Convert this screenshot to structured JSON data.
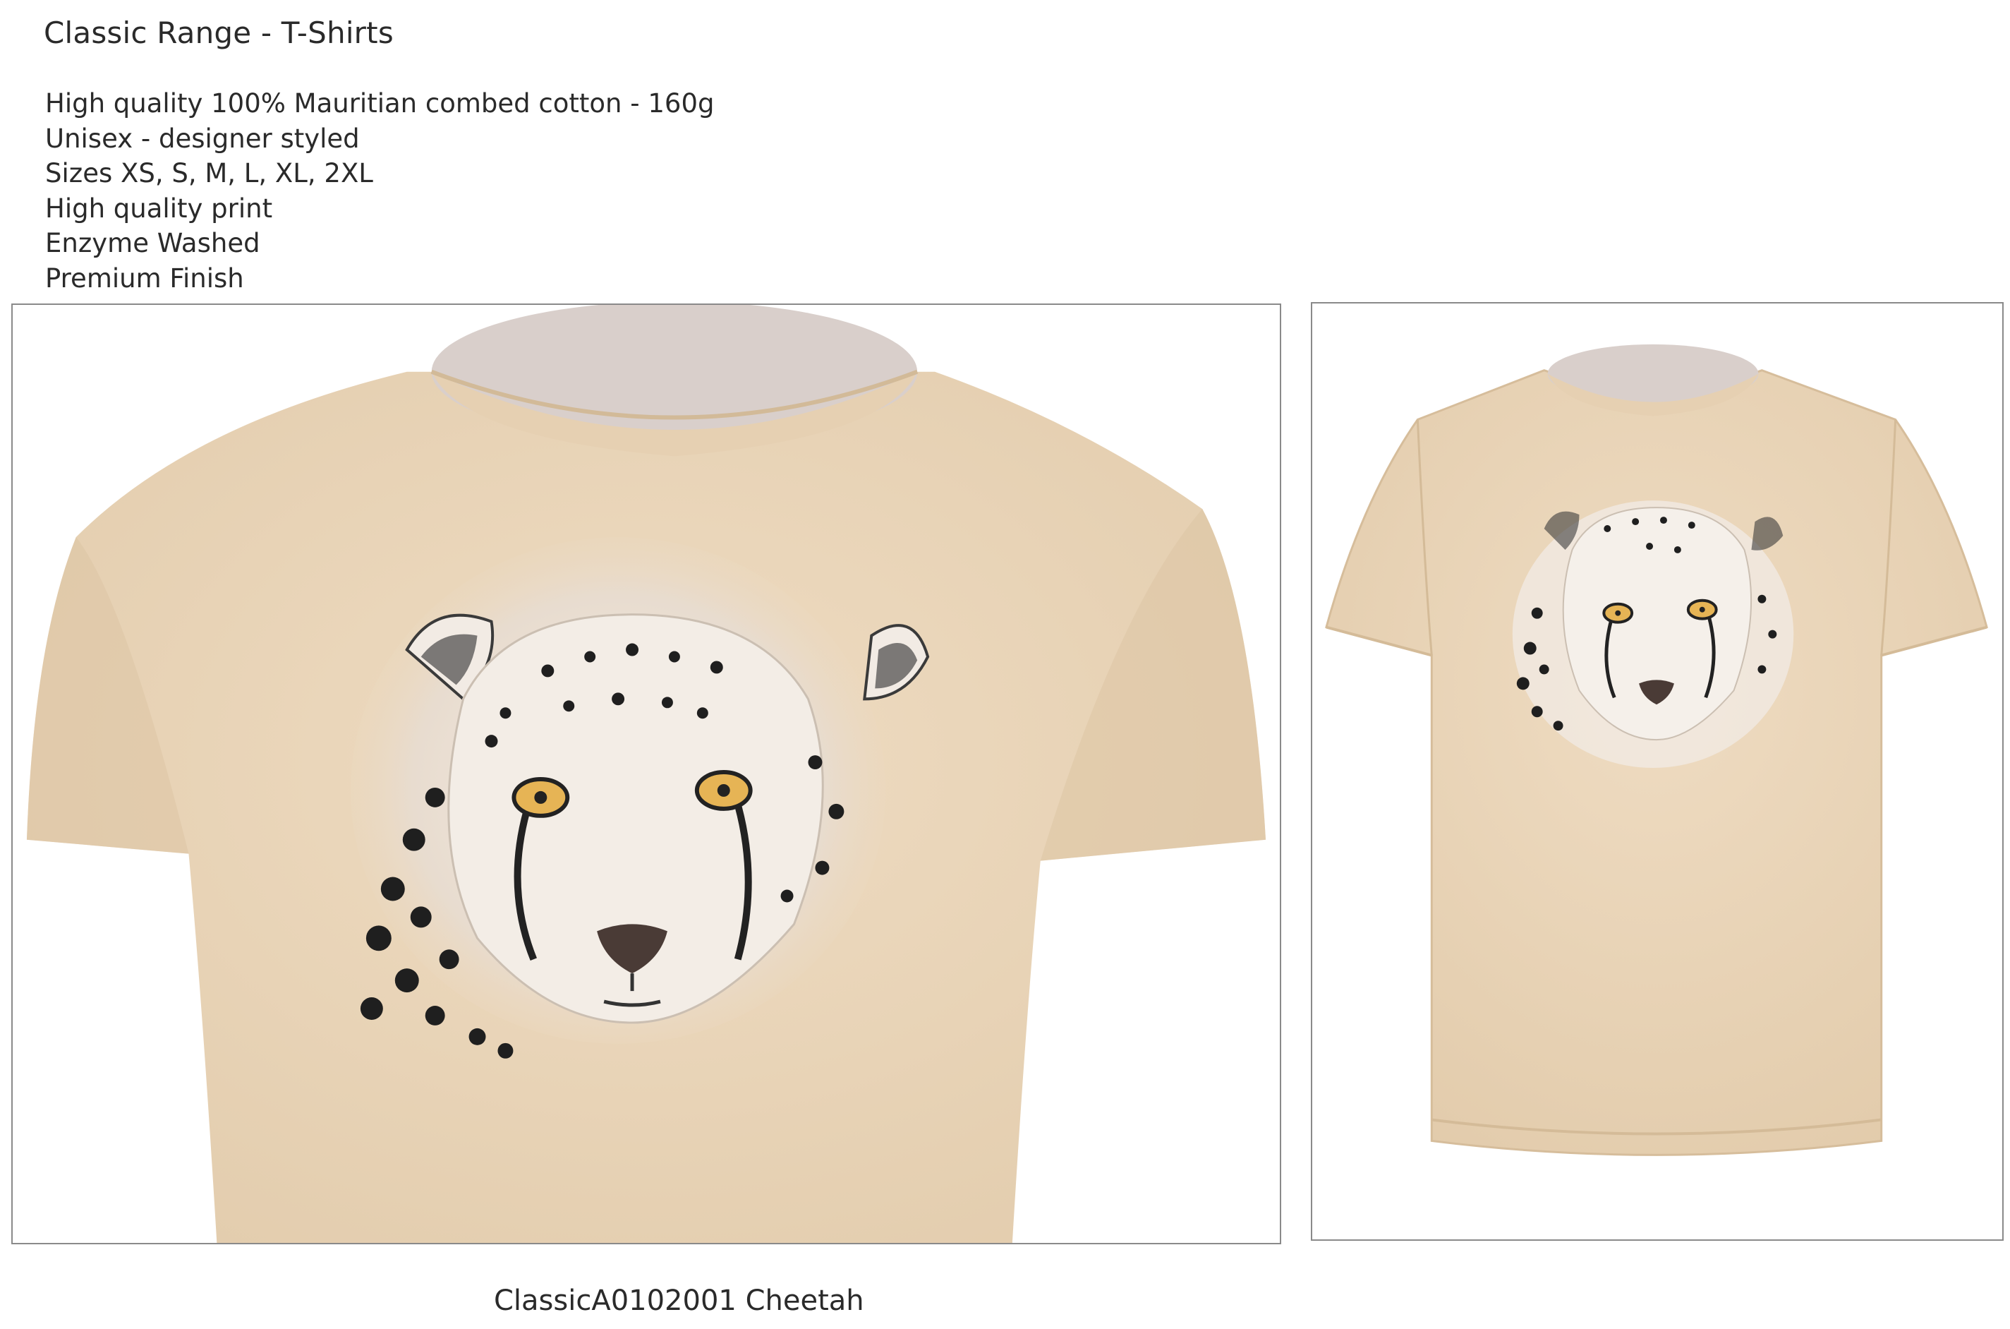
{
  "product": {
    "title": "Classic Range - T-Shirts",
    "features": [
      "High quality 100% Mauritian combed cotton - 160g",
      "Unisex - designer styled",
      "Sizes XS, S, M, L, XL, 2XL",
      "High quality print",
      "Enzyme Washed",
      "Premium Finish"
    ],
    "caption": "ClassicA0102001 Cheetah"
  },
  "images": {
    "closeup": {
      "icon": "tshirt-closeup-cheetah-print"
    },
    "full": {
      "icon": "tshirt-full-cheetah-print"
    }
  },
  "colors": {
    "shirt": "#ecd8bc",
    "shirt_shadow": "#dcc4a4",
    "collar_inner": "#d9cfcb",
    "frame_border": "#8a8a8a",
    "text": "#2a2a2a"
  }
}
